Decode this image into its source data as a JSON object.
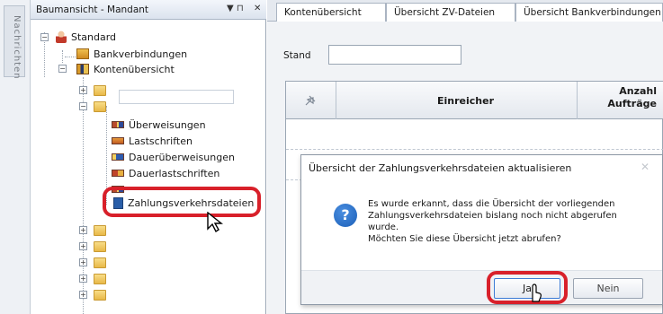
{
  "side_strip": {
    "label": "Nachrichten"
  },
  "tree_panel": {
    "title": "Baumansicht - Mandant",
    "pin_glyph": "▼ ⊓",
    "close_glyph": "✕",
    "nodes": {
      "standard": "Standard",
      "bankverbindungen": "Bankverbindungen",
      "kontenuebersicht": "Kontenübersicht",
      "ueberweisungen": "Überweisungen",
      "lastschriften": "Lastschriften",
      "dauerueberweisungen": "Dauerüberweisungen",
      "dauerlastschriften": "Dauerlastschriften",
      "zahlungsverkehrsdateien": "Zahlungsverkehrsdateien"
    },
    "expander_plus": "+",
    "expander_minus": "−"
  },
  "content": {
    "tabs": [
      "Kontenübersicht",
      "Übersicht ZV-Dateien",
      "Übersicht Bankverbindungen"
    ],
    "stand_label": "Stand",
    "stand_value": "",
    "grid": {
      "columns": [
        "Einreicher",
        "Anzahl Aufträge"
      ],
      "rows": []
    }
  },
  "dialog": {
    "title": "Übersicht der Zahlungsverkehrsdateien aktualisieren",
    "close_glyph": "✕",
    "icon_glyph": "?",
    "message_lines": [
      "Es wurde erkannt, dass die Übersicht der vorliegenden",
      "Zahlungsverkehrsdateien bislang noch nicht abgerufen",
      "wurde.",
      "Möchten Sie diese Übersicht jetzt abrufen?"
    ],
    "yes_label": "Ja",
    "no_label": "Nein"
  },
  "colors": {
    "highlight_ring": "#d8202a",
    "accent": "#3d7cd6"
  }
}
